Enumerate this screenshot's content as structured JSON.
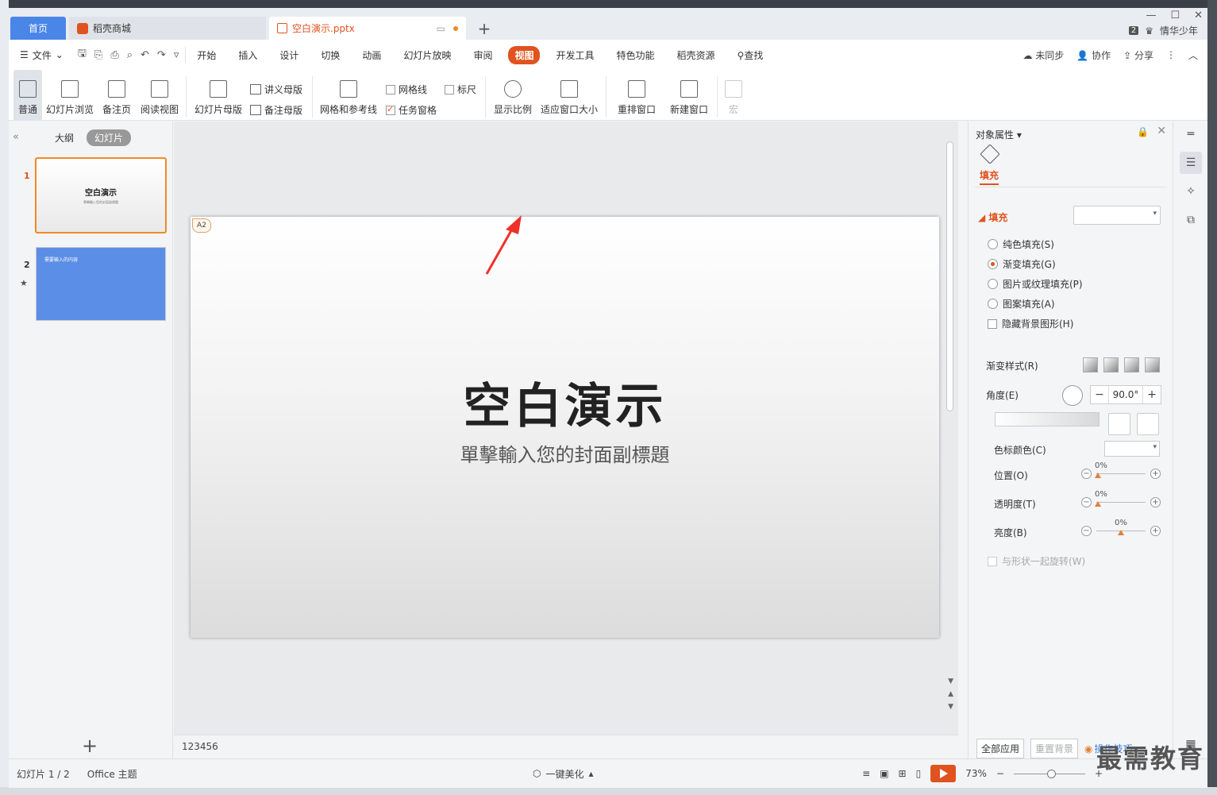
{
  "tabs": {
    "home": "首页",
    "store": "稻壳商城",
    "document": "空白演示.pptx"
  },
  "user": {
    "badge": "2",
    "name": "情华少年"
  },
  "menu": {
    "file": "文件",
    "items": [
      "开始",
      "插入",
      "设计",
      "切换",
      "动画",
      "幻灯片放映",
      "审阅",
      "视图",
      "开发工具",
      "特色功能",
      "稻壳资源"
    ],
    "active": "视图",
    "search": "查找",
    "sync": "未同步",
    "collab": "协作",
    "share": "分享"
  },
  "ribbon": {
    "normal": "普通",
    "slide_sorter": "幻灯片浏览",
    "notes_page": "备注页",
    "reading_view": "阅读视图",
    "slide_master": "幻灯片母版",
    "handout_master": "讲义母版",
    "notes_master": "备注母版",
    "grid_guides": "网格和参考线",
    "gridlines": "网格线",
    "ruler": "标尺",
    "task_pane": "任务窗格",
    "zoom": "显示比例",
    "fit_window": "适应窗口大小",
    "arrange": "重排窗口",
    "new_window": "新建窗口",
    "macro": "宏"
  },
  "left_panel": {
    "outline_tab": "大纲",
    "slides_tab": "幻灯片",
    "slide1_num": "1",
    "slide1_title": "空白演示",
    "slide1_sub": "單擊輸入您的封面副標題",
    "slide2_num": "2",
    "slide2_title": "需要输入的内容"
  },
  "slide": {
    "tag": "A2",
    "title": "空白演示",
    "subtitle": "單擊輸入您的封面副標題"
  },
  "notes_text": "123456",
  "right_panel": {
    "title": "对象属性",
    "tab_fill": "填充",
    "fill_header": "填充",
    "options": [
      "纯色填充(S)",
      "渐变填充(G)",
      "图片或纹理填充(P)",
      "图案填充(A)"
    ],
    "selected_option": 1,
    "hide_bg": "隐藏背景图形(H)",
    "gradient_style": "渐变样式(R)",
    "angle_label": "角度(E)",
    "angle_value": "90.0°",
    "stop_color": "色标颜色(C)",
    "position_label": "位置(O)",
    "transparency_label": "透明度(T)",
    "brightness_label": "亮度(B)",
    "position_value": "0%",
    "transparency_value": "0%",
    "brightness_value": "0%",
    "rotate_with_shape": "与形状一起旋转(W)",
    "apply_all": "全部应用",
    "reset_bg": "重置背景",
    "tips": "操作技巧"
  },
  "status": {
    "slide_count": "幻灯片 1 / 2",
    "theme": "Office 主题",
    "beautify": "一键美化",
    "zoom": "73%"
  },
  "watermark": "最需教育",
  "colors": {
    "accent": "#e0531f",
    "home_tab": "#4a86e8",
    "slide2_bg": "#5b8ee6"
  }
}
